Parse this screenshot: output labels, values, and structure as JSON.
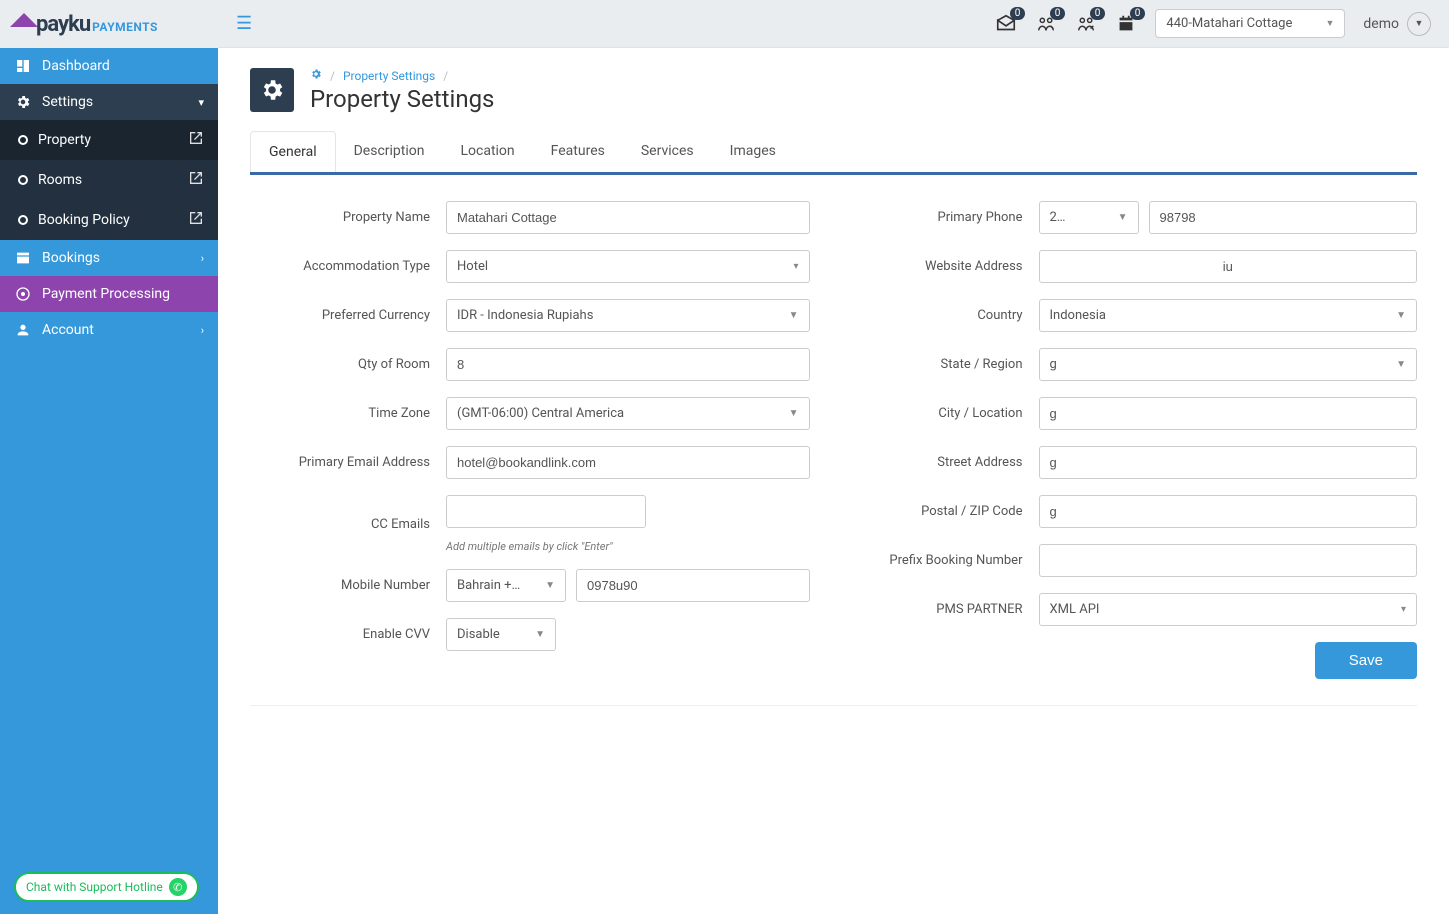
{
  "logo": {
    "word": "payku",
    "sub": "PAYMENTS"
  },
  "topbar": {
    "badges": {
      "inbox": "0",
      "checkin": "0",
      "checkout": "0",
      "calendar": "0"
    },
    "property_selected": "440-Matahari Cottage",
    "user": "demo"
  },
  "sidebar": {
    "items": [
      {
        "label": "Dashboard"
      },
      {
        "label": "Settings"
      },
      {
        "label": "Bookings"
      },
      {
        "label": "Payment Processing"
      },
      {
        "label": "Account"
      }
    ],
    "settings_sub": [
      {
        "label": "Property"
      },
      {
        "label": "Rooms"
      },
      {
        "label": "Booking Policy"
      }
    ],
    "support": "Chat with Support Hotline"
  },
  "breadcrumb": {
    "link": "Property Settings"
  },
  "page_title": "Property Settings",
  "tabs": [
    "General",
    "Description",
    "Location",
    "Features",
    "Services",
    "Images"
  ],
  "labels": {
    "property_name": "Property Name",
    "accommodation_type": "Accommodation Type",
    "preferred_currency": "Preferred Currency",
    "qty_room": "Qty of Room",
    "time_zone": "Time Zone",
    "primary_email": "Primary Email Address",
    "cc_emails": "CC Emails",
    "cc_hint": "Add multiple emails by click \"Enter\"",
    "mobile_number": "Mobile Number",
    "enable_cvv": "Enable CVV",
    "primary_phone": "Primary Phone",
    "website": "Website Address",
    "country": "Country",
    "state": "State / Region",
    "city": "City / Location",
    "street": "Street Address",
    "postal": "Postal / ZIP Code",
    "prefix_booking": "Prefix Booking Number",
    "pms_partner": "PMS PARTNER",
    "save": "Save"
  },
  "form": {
    "property_name": "Matahari Cottage",
    "accommodation_type": "Hotel",
    "preferred_currency": "IDR - Indonesia Rupiahs",
    "qty_room": "8",
    "time_zone": "(GMT-06:00) Central America",
    "primary_email": "hotel@bookandlink.com",
    "cc_emails": "",
    "mobile_cc": "Bahrain +…",
    "mobile_number": "0978u90",
    "enable_cvv": "Disable",
    "phone_cc": "2…",
    "phone_number": "98798",
    "website": "iu",
    "country": "Indonesia",
    "state": "g",
    "city": "g",
    "street": "g",
    "postal": "g",
    "prefix_booking": "",
    "pms_partner": "XML API"
  }
}
